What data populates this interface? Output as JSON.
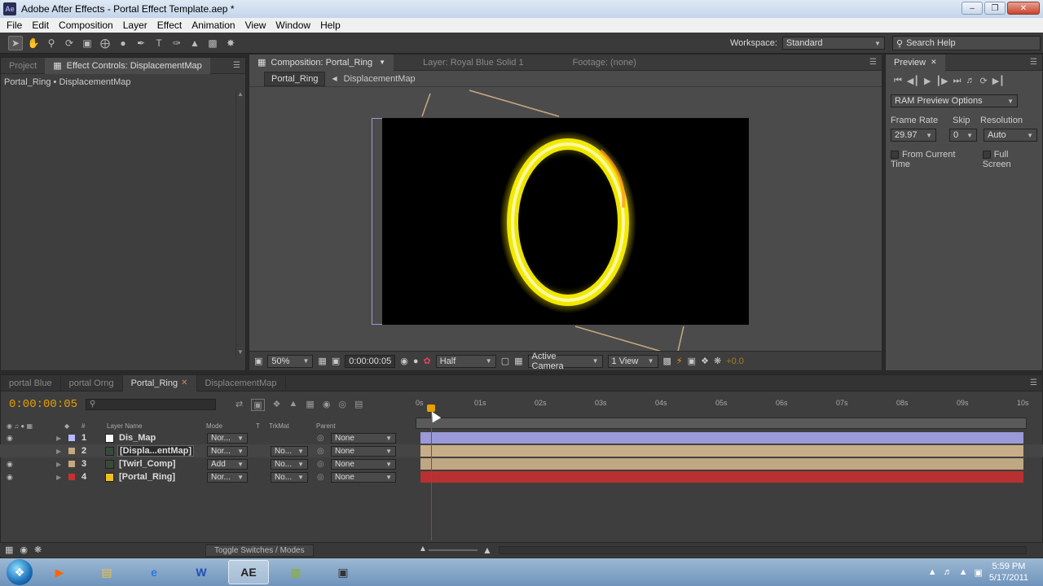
{
  "window": {
    "title": "Adobe After Effects - Portal Effect Template.aep *",
    "app_icon": "Ae"
  },
  "menu": [
    "File",
    "Edit",
    "Composition",
    "Layer",
    "Effect",
    "Animation",
    "View",
    "Window",
    "Help"
  ],
  "toolbar": {
    "workspace_label": "Workspace:",
    "workspace_value": "Standard",
    "search_placeholder": "Search Help"
  },
  "left_panel": {
    "tabs": [
      "Project",
      "Effect Controls: DisplacementMap"
    ],
    "breadcrumb": "Portal_Ring • DisplacementMap"
  },
  "comp_panel": {
    "tabs": [
      "Composition: Portal_Ring",
      "Layer: Royal Blue Solid 1",
      "Footage: (none)"
    ],
    "crumbs": [
      "Portal_Ring",
      "DisplacementMap"
    ],
    "zoom": "50%",
    "timecode": "0:00:00:05",
    "resolution": "Half",
    "camera": "Active Camera",
    "views": "1 View",
    "exposure": "+0.0"
  },
  "preview_panel": {
    "tab": "Preview",
    "ram_preview": "RAM Preview Options",
    "frame_rate_label": "Frame Rate",
    "skip_label": "Skip",
    "resolution_label": "Resolution",
    "frame_rate": "29.97",
    "skip": "0",
    "resolution": "Auto",
    "from_current_time": "From Current Time",
    "full_screen": "Full Screen"
  },
  "timeline": {
    "tabs": [
      "portal Blue",
      "portal Orng",
      "Portal_Ring",
      "DisplacementMap"
    ],
    "timecode": "0:00:00:05",
    "ruler": [
      "0s",
      "01s",
      "02s",
      "03s",
      "04s",
      "05s",
      "06s",
      "07s",
      "08s",
      "09s",
      "10s"
    ],
    "col_headers": {
      "num": "#",
      "layer_name": "Layer Name",
      "mode": "Mode",
      "t": "T",
      "trkmat": "TrkMat",
      "parent": "Parent"
    },
    "layers": [
      {
        "num": "1",
        "name": "Dis_Map",
        "mode": "Nor...",
        "trkmat": "",
        "parent": "None",
        "label_color": "#b8b8ff",
        "thumb": "#ffffff",
        "bar": "#9a9ad8"
      },
      {
        "num": "2",
        "name": "[Displa...entMap]",
        "mode": "Nor...",
        "trkmat": "No...",
        "parent": "None",
        "label_color": "#c6a97c",
        "thumb": "#3a4a3a",
        "bar": "#c8ae88"
      },
      {
        "num": "3",
        "name": "[Twirl_Comp]",
        "mode": "Add",
        "trkmat": "No...",
        "parent": "None",
        "label_color": "#c6a97c",
        "thumb": "#3a4a3a",
        "bar": "#bfa783"
      },
      {
        "num": "4",
        "name": "[Portal_Ring]",
        "mode": "Nor...",
        "trkmat": "No...",
        "parent": "None",
        "label_color": "#c83030",
        "thumb": "#f0c020",
        "bar": "#b83030"
      }
    ],
    "footer_toggle": "Toggle Switches / Modes"
  },
  "taskbar": {
    "time": "5:59 PM",
    "date": "5/17/2011",
    "active_app": "AE"
  }
}
